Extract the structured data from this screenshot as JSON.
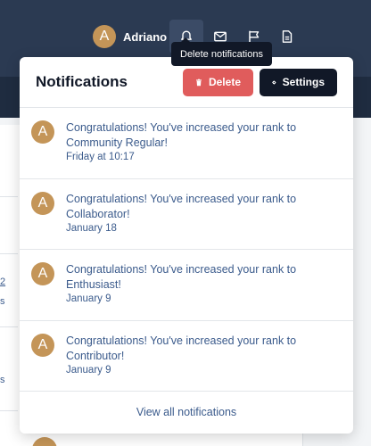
{
  "header": {
    "user": {
      "initial": "A",
      "name": "Adriano"
    },
    "icons": [
      "bell-icon",
      "mail-icon",
      "flag-icon",
      "document-icon"
    ],
    "tooltip": "Delete notifications"
  },
  "panel": {
    "title": "Notifications",
    "delete_label": "Delete",
    "settings_label": "Settings",
    "items": [
      {
        "initial": "A",
        "text": "Congratulations! You've increased your rank to Community Regular!",
        "time": "Friday at 10:17"
      },
      {
        "initial": "A",
        "text": "Congratulations! You've increased your rank to Collaborator!",
        "time": "January 18"
      },
      {
        "initial": "A",
        "text": "Congratulations! You've increased your rank to Enthusiast!",
        "time": "January 9"
      },
      {
        "initial": "A",
        "text": "Congratulations! You've increased your rank to Contributor!",
        "time": "January 9"
      }
    ],
    "view_all": "View all notifications"
  },
  "background": {
    "fragments": [
      "2",
      "s",
      "s"
    ]
  },
  "colors": {
    "header_bg": "#2b3a52",
    "avatar": "#c49558",
    "delete": "#e05c5c",
    "settings": "#111827",
    "link": "#3b5b8c"
  }
}
